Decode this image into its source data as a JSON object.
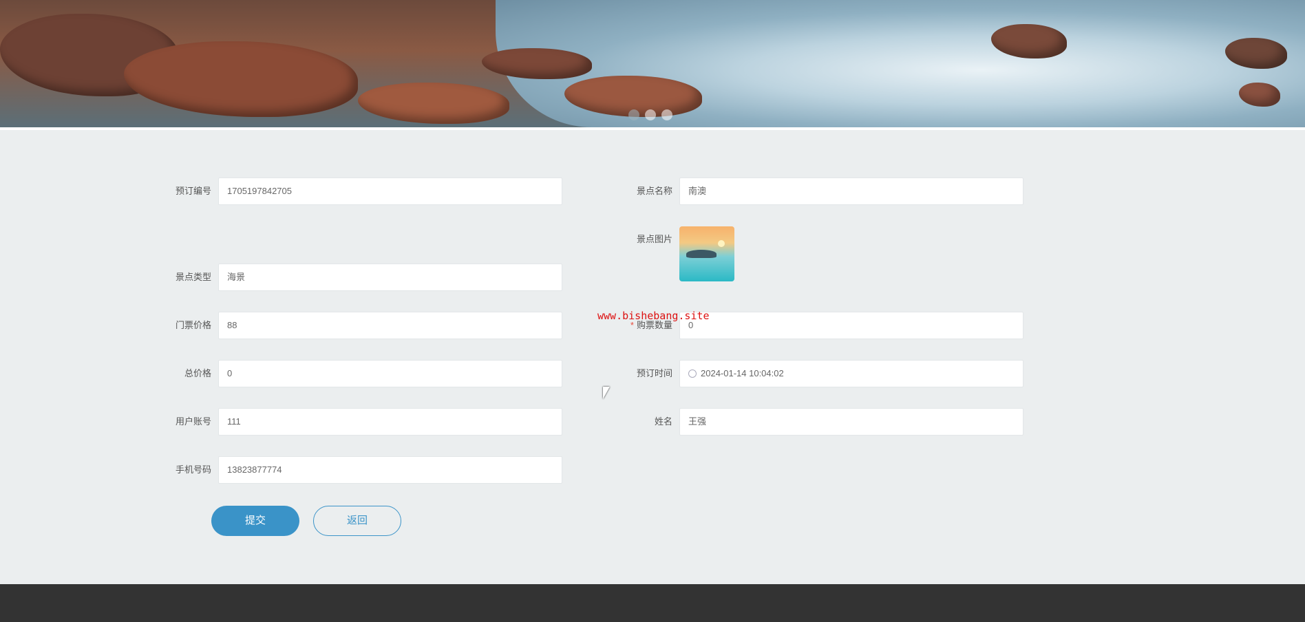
{
  "banner": {
    "slides": 3,
    "active_slide": 0
  },
  "form": {
    "order_no": {
      "label": "预订编号",
      "value": "1705197842705"
    },
    "spot_name": {
      "label": "景点名称",
      "value": "南澳"
    },
    "spot_image": {
      "label": "景点图片"
    },
    "spot_type": {
      "label": "景点类型",
      "value": "海景"
    },
    "ticket_price": {
      "label": "门票价格",
      "value": "88"
    },
    "ticket_qty": {
      "label": "购票数量",
      "required_mark": "*",
      "value": "0"
    },
    "total_price": {
      "label": "总价格",
      "value": "0"
    },
    "order_time": {
      "label": "预订时间",
      "value": "2024-01-14 10:04:02"
    },
    "user_account": {
      "label": "用户账号",
      "value": "111"
    },
    "name": {
      "label": "姓名",
      "value": "王强"
    },
    "phone": {
      "label": "手机号码",
      "value": "13823877774"
    }
  },
  "buttons": {
    "submit": "提交",
    "back": "返回"
  },
  "watermark": "www.bishebang.site",
  "colors": {
    "primary": "#3a93c8",
    "page_bg": "#ebeeef",
    "footer_bg": "#333333"
  }
}
